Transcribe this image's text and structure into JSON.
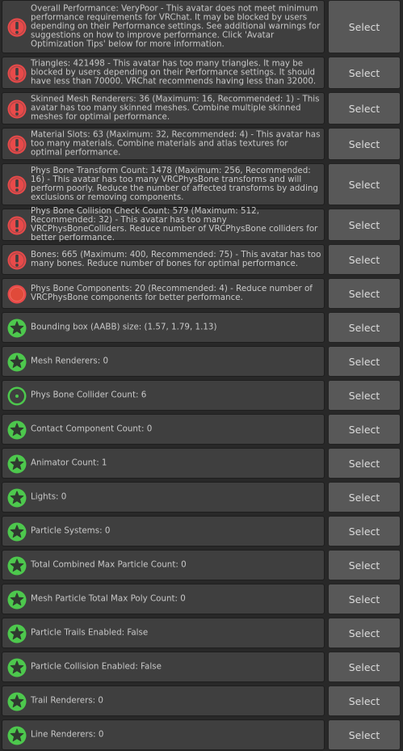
{
  "button_label": "Select",
  "colors": {
    "error_red": "#e84a4a",
    "good_green": "#4dc84d",
    "row_bg": "#3f3f3f",
    "button_bg": "#585858"
  },
  "items": [
    {
      "status": "error",
      "icon": "error-exclamation-icon",
      "text": "Overall Performance: VeryPoor - This avatar does not meet minimum performance requirements for VRChat. It may be blocked by users depending on their Performance settings. See additional warnings for suggestions on how to improve performance. Click 'Avatar Optimization Tips' below for more information."
    },
    {
      "status": "error",
      "icon": "error-exclamation-icon",
      "text": "Triangles: 421498 - This avatar has too many triangles. It may be blocked by users depending on their Performance settings. It should have less than 70000. VRChat recommends having less than 32000."
    },
    {
      "status": "error",
      "icon": "error-exclamation-icon",
      "text": "Skinned Mesh Renderers: 36 (Maximum: 16, Recommended: 1) - This avatar has too many skinned meshes. Combine multiple skinned meshes for optimal performance."
    },
    {
      "status": "error",
      "icon": "error-exclamation-icon",
      "text": "Material Slots: 63 (Maximum: 32, Recommended: 4) - This avatar has too many materials. Combine materials and atlas textures for optimal performance."
    },
    {
      "status": "error",
      "icon": "error-exclamation-icon",
      "text": "Phys Bone Transform Count: 1478 (Maximum: 256, Recommended: 16) - This avatar has too many VRCPhysBone transforms and will perform poorly. Reduce the number of affected transforms by adding exclusions or removing components."
    },
    {
      "status": "error",
      "icon": "error-exclamation-icon",
      "text": "Phys Bone Collision Check Count: 579 (Maximum: 512, Recommended: 32) - This avatar has too many VRCPhysBoneColliders. Reduce number of VRCPhysBone colliders for better performance."
    },
    {
      "status": "error",
      "icon": "error-exclamation-icon",
      "text": "Bones: 665 (Maximum: 400, Recommended: 75) - This avatar has too many bones. Reduce number of bones for optimal performance."
    },
    {
      "status": "poor",
      "icon": "red-circle-icon",
      "text": "Phys Bone Components: 20 (Recommended: 4) - Reduce number of VRCPhysBone components for better performance."
    },
    {
      "status": "good",
      "icon": "green-star-icon",
      "text": "Bounding box (AABB) size: (1.57, 1.79, 1.13)"
    },
    {
      "status": "good",
      "icon": "green-star-icon",
      "text": "Mesh Renderers: 0"
    },
    {
      "status": "good-ring",
      "icon": "green-ring-dot-icon",
      "text": "Phys Bone Collider Count: 6"
    },
    {
      "status": "good",
      "icon": "green-star-icon",
      "text": "Contact Component Count: 0"
    },
    {
      "status": "good",
      "icon": "green-star-icon",
      "text": "Animator Count: 1"
    },
    {
      "status": "good",
      "icon": "green-star-icon",
      "text": "Lights: 0"
    },
    {
      "status": "good",
      "icon": "green-star-icon",
      "text": "Particle Systems: 0"
    },
    {
      "status": "good",
      "icon": "green-star-icon",
      "text": "Total Combined Max Particle Count: 0"
    },
    {
      "status": "good",
      "icon": "green-star-icon",
      "text": "Mesh Particle Total Max Poly Count: 0"
    },
    {
      "status": "good",
      "icon": "green-star-icon",
      "text": "Particle Trails Enabled: False"
    },
    {
      "status": "good",
      "icon": "green-star-icon",
      "text": "Particle Collision Enabled: False"
    },
    {
      "status": "good",
      "icon": "green-star-icon",
      "text": "Trail Renderers: 0"
    },
    {
      "status": "good",
      "icon": "green-star-icon",
      "text": "Line Renderers: 0"
    }
  ]
}
